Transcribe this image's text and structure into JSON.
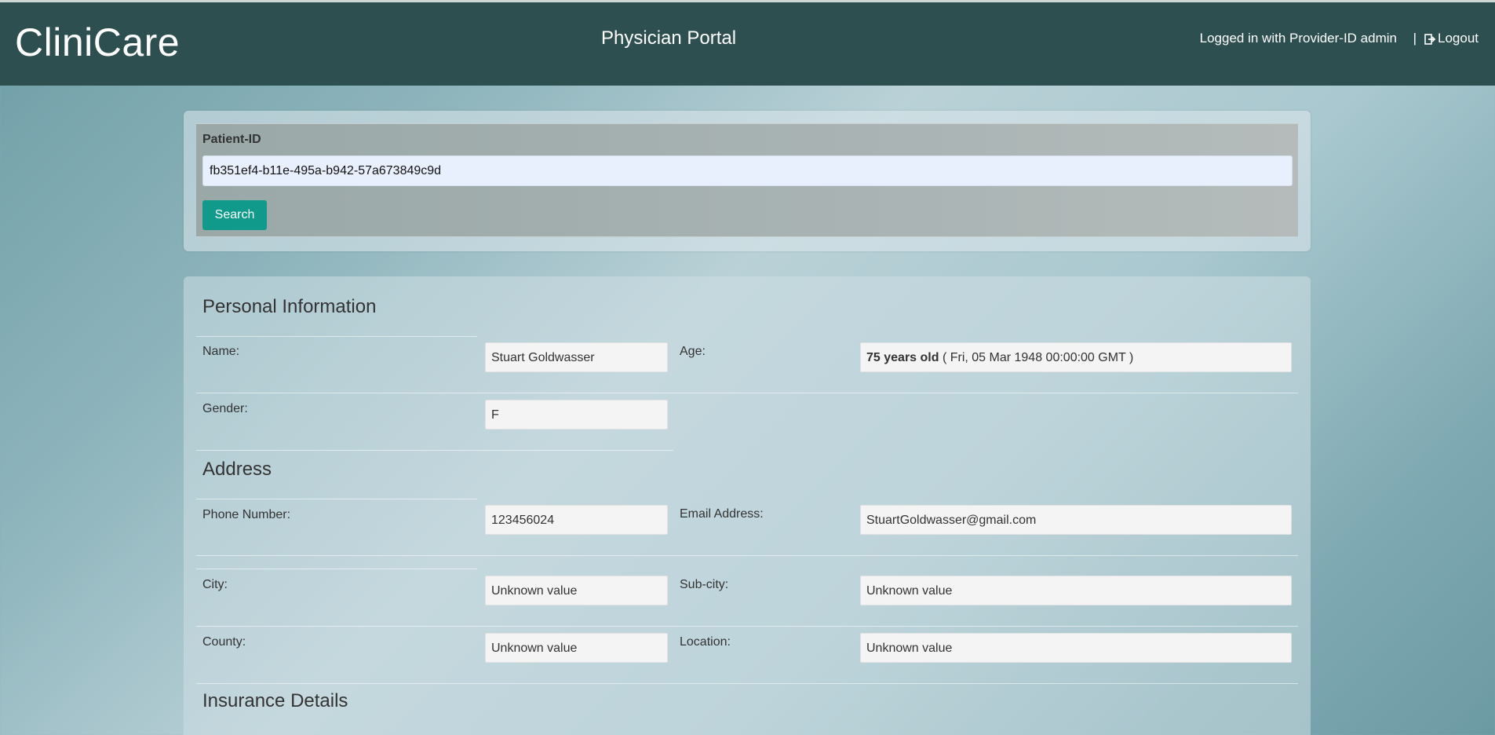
{
  "navbar": {
    "brand": "CliniCare",
    "title": "Physician Portal",
    "login_info": "Logged in with Provider-ID admin",
    "separator": "|",
    "logout_label": "Logout"
  },
  "search": {
    "label": "Patient-ID",
    "value": "fb351ef4-b11e-495a-b942-57a673849c9d",
    "button_label": "Search"
  },
  "personal": {
    "title": "Personal Information",
    "name_label": "Name:",
    "name_value": "Stuart Goldwasser",
    "age_label": "Age:",
    "age_years": "75 years old",
    "age_dob": " ( Fri, 05 Mar 1948 00:00:00 GMT )",
    "gender_label": "Gender:",
    "gender_value": "F"
  },
  "address": {
    "title": "Address",
    "phone_label": "Phone Number:",
    "phone_value": "123456024",
    "email_label": "Email Address:",
    "email_value": "StuartGoldwasser@gmail.com",
    "city_label": "City:",
    "city_value": "Unknown value",
    "subcity_label": "Sub-city:",
    "subcity_value": "Unknown value",
    "county_label": "County:",
    "county_value": "Unknown value",
    "location_label": "Location:",
    "location_value": "Unknown value"
  },
  "insurance": {
    "title": "Insurance Details"
  }
}
